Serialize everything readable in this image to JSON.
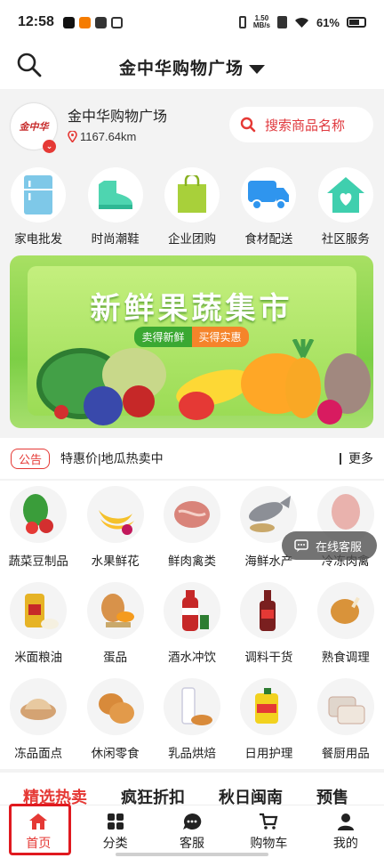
{
  "status_bar": {
    "time": "12:58",
    "net_speed_top": "1.50",
    "net_speed_bottom": "MB/s",
    "battery": "61%"
  },
  "header": {
    "title": "金中华购物广场"
  },
  "store": {
    "logo_text": "金中华",
    "name": "金中华购物广场",
    "distance": "1167.64km",
    "search_placeholder": "搜索商品名称"
  },
  "top_categories": [
    {
      "label": "家电批发",
      "icon": "fridge-icon",
      "color": "#7ec8e8"
    },
    {
      "label": "时尚潮鞋",
      "icon": "shoe-icon",
      "color": "#4ed5b0"
    },
    {
      "label": "企业团购",
      "icon": "bag-icon",
      "color": "#a8d03a"
    },
    {
      "label": "食材配送",
      "icon": "truck-icon",
      "color": "#2f95ee"
    },
    {
      "label": "社区服务",
      "icon": "house-heart-icon",
      "color": "#3fcfae"
    }
  ],
  "banner": {
    "title": "新鲜果蔬集市",
    "pill_left": "卖得新鲜",
    "pill_right": "买得实惠"
  },
  "notice": {
    "tag": "公告",
    "text": "特惠价|地瓜热卖中",
    "more": "更多"
  },
  "product_categories": [
    {
      "label": "蔬菜豆制品",
      "icon": "vegetable-icon",
      "color": "#3a9d3a"
    },
    {
      "label": "水果鲜花",
      "icon": "banana-icon",
      "color": "#f4c12b"
    },
    {
      "label": "鲜肉禽类",
      "icon": "meat-icon",
      "color": "#d9847a"
    },
    {
      "label": "海鲜水产",
      "icon": "fish-icon",
      "color": "#8c8f96"
    },
    {
      "label": "冷冻肉禽",
      "icon": "frozen-meat-icon",
      "color": "#e9b2ad"
    },
    {
      "label": "米面粮油",
      "icon": "oil-icon",
      "color": "#e6b325"
    },
    {
      "label": "蛋品",
      "icon": "egg-icon",
      "color": "#d8924a"
    },
    {
      "label": "酒水冲饮",
      "icon": "cola-icon",
      "color": "#c62828"
    },
    {
      "label": "调料干货",
      "icon": "sauce-icon",
      "color": "#7a1f1f"
    },
    {
      "label": "熟食调理",
      "icon": "fried-chicken-icon",
      "color": "#d9933a"
    },
    {
      "label": "冻品面点",
      "icon": "dumpling-icon",
      "color": "#e8c9a0"
    },
    {
      "label": "休闲零食",
      "icon": "bread-icon",
      "color": "#d88a3a"
    },
    {
      "label": "乳品烘焙",
      "icon": "milk-icon",
      "color": "#d9d9e8"
    },
    {
      "label": "日用护理",
      "icon": "detergent-icon",
      "color": "#f2d21f"
    },
    {
      "label": "餐厨用品",
      "icon": "lunchbox-icon",
      "color": "#caa898"
    }
  ],
  "customer_service_float": "在线客服",
  "section_tabs": [
    "精选热卖",
    "疯狂折扣",
    "秋日闽南",
    "预售"
  ],
  "bottom_nav": [
    {
      "label": "首页",
      "icon": "home-icon"
    },
    {
      "label": "分类",
      "icon": "grid-icon"
    },
    {
      "label": "客服",
      "icon": "chat-icon"
    },
    {
      "label": "购物车",
      "icon": "cart-icon"
    },
    {
      "label": "我的",
      "icon": "user-icon"
    }
  ],
  "colors": {
    "accent": "#e53935",
    "banner_green": "#7ccf45"
  }
}
